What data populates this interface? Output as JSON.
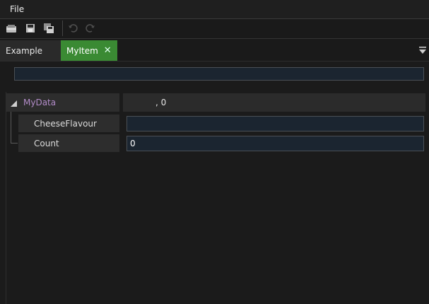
{
  "menu": {
    "file_label": "File"
  },
  "toolbar": {
    "buttons": [
      "open-icon",
      "save-icon",
      "save-all-icon",
      "undo-icon",
      "redo-icon"
    ]
  },
  "tabs": [
    {
      "label": "Example",
      "active": false
    },
    {
      "label": "MyItem",
      "active": true,
      "close_glyph": "✕"
    }
  ],
  "filter": {
    "value": ""
  },
  "properties": {
    "group": {
      "name": "MyData",
      "value": ", 0"
    },
    "items": [
      {
        "name": "CheeseFlavour",
        "value": ""
      },
      {
        "name": "Count",
        "value": "0"
      }
    ]
  },
  "colors": {
    "accent_tab": "#3a8a33",
    "group_label": "#b38cc9",
    "input_bg": "#1b2530"
  }
}
